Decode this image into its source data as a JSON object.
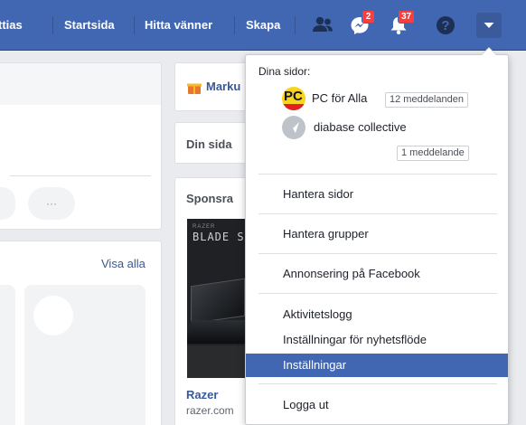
{
  "topbar": {
    "nav": [
      "ttias",
      "Startsida",
      "Hitta vänner",
      "Skapa"
    ],
    "friend_requests_icon": "friends-icon",
    "messenger_badge": "2",
    "notifications_badge": "37",
    "help_icon": "question-icon",
    "menu_icon": "caret-down-icon"
  },
  "background": {
    "right_header": "Marku",
    "your_page": "Din sida",
    "sponsored": "Sponsra",
    "visa_alla": "Visa alla",
    "ad_banner_text": "BLADE S",
    "ad_brand": "Razer",
    "ad_url": "razer.com",
    "more_dots": "···"
  },
  "dropdown": {
    "section_title": "Dina sidor:",
    "pages": [
      {
        "name": "PC för Alla",
        "badge": "12 meddelanden",
        "logo_text": "PC"
      },
      {
        "name": "diabase collective",
        "badge": "1 meddelande"
      }
    ],
    "items": [
      "Hantera sidor",
      "Hantera grupper",
      "Annonsering på Facebook",
      "Aktivitetslogg",
      "Inställningar för nyhetsflöde",
      "Inställningar",
      "Logga ut"
    ]
  },
  "colors": {
    "brand": "#4267b2",
    "badge": "#fa3e3e"
  }
}
